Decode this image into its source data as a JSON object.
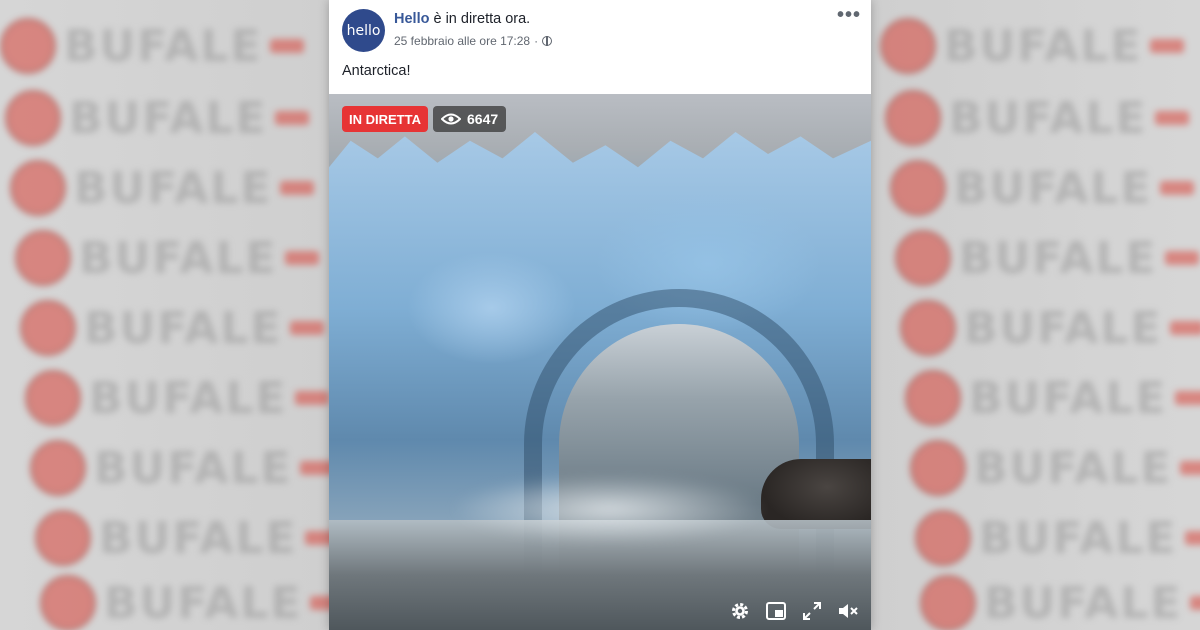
{
  "post": {
    "avatar_text": "hello",
    "page_name": "Hello",
    "status_text": " è in diretta ora.",
    "date": "25 febbraio alle ore 17:28",
    "separator": "·",
    "text": "Antarctica!",
    "more_icon": "•••"
  },
  "video": {
    "live_label": "IN DIRETTA",
    "viewer_count": "6647"
  },
  "watermark": {
    "word": "BUFALE"
  },
  "icons": [
    "more-options-icon",
    "globe-icon",
    "eye-icon",
    "settings-icon",
    "picture-in-picture-icon",
    "fullscreen-icon",
    "mute-icon"
  ],
  "colors": {
    "live_red": "#e73435",
    "link_blue": "#385898",
    "avatar_bg": "#2f4a8c"
  }
}
